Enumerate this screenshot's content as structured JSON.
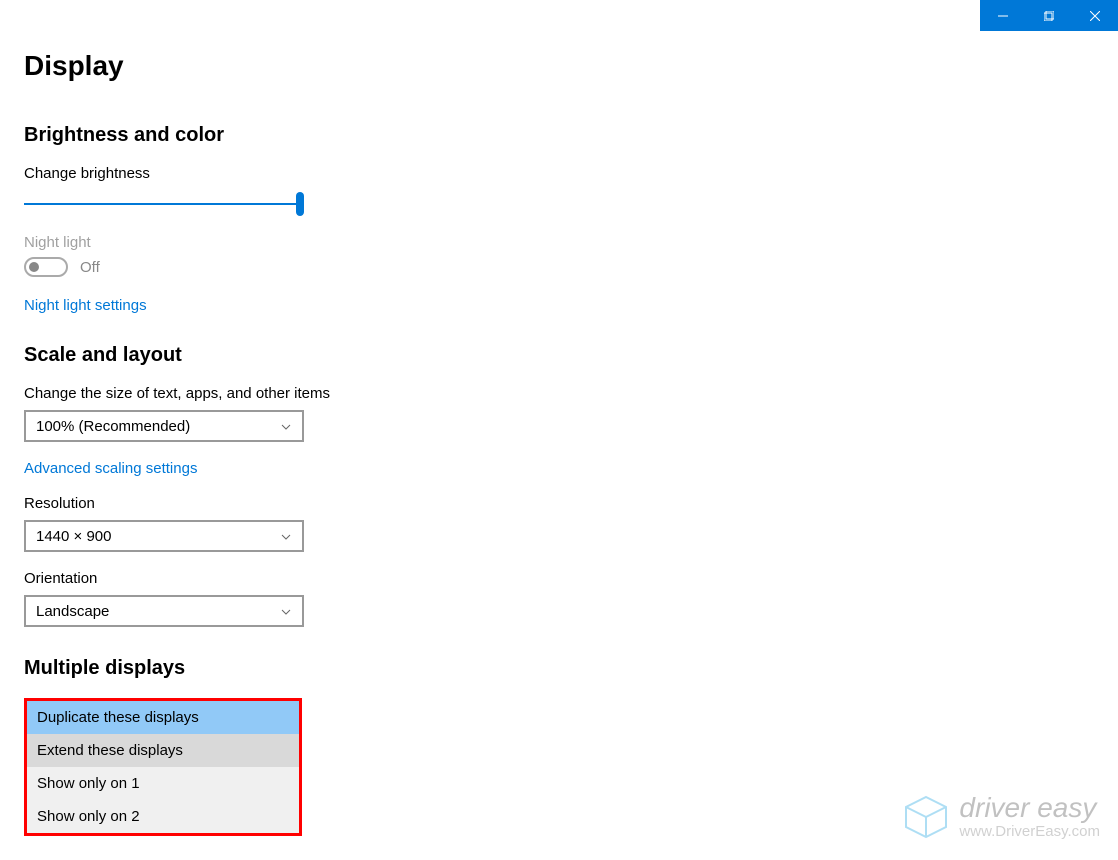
{
  "titlebar": {
    "minimize": "minimize",
    "maximize": "maximize",
    "close": "close"
  },
  "page": {
    "title": "Display"
  },
  "brightness_section": {
    "header": "Brightness and color",
    "change_brightness_label": "Change brightness",
    "night_light_label": "Night light",
    "night_light_state": "Off",
    "night_light_settings_link": "Night light settings"
  },
  "scale_section": {
    "header": "Scale and layout",
    "scale_label": "Change the size of text, apps, and other items",
    "scale_value": "100% (Recommended)",
    "advanced_scaling_link": "Advanced scaling settings",
    "resolution_label": "Resolution",
    "resolution_value": "1440 × 900",
    "orientation_label": "Orientation",
    "orientation_value": "Landscape"
  },
  "multiple_displays": {
    "header": "Multiple displays",
    "options": [
      "Duplicate these displays",
      "Extend these displays",
      "Show only on 1",
      "Show only on 2"
    ]
  },
  "watermark": {
    "brand": "driver easy",
    "url": "www.DriverEasy.com"
  }
}
